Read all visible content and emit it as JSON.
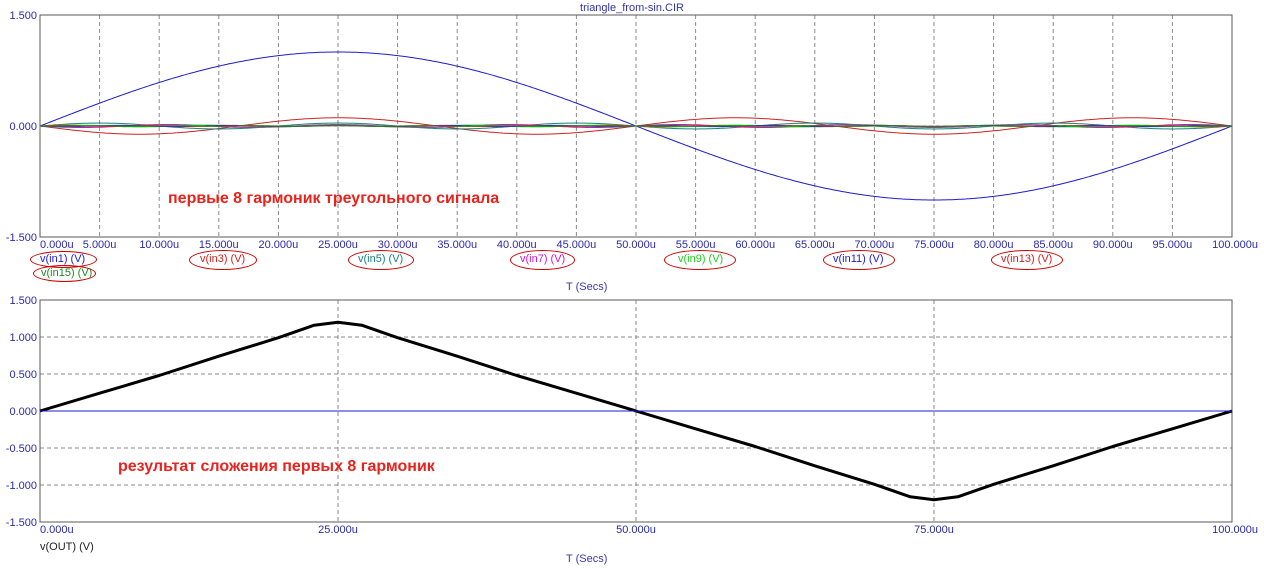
{
  "window": {
    "title": "triangle_from-sin.CIR"
  },
  "colors": {
    "axis_text": "#2a2aa8",
    "grid": "#8a8a8a",
    "annotation": "#e8221c",
    "ellipse": "#cc0000"
  },
  "top_panel": {
    "annotation": "первые 8 гармоник треугольного сигнала",
    "xtitle": "T (Secs)",
    "legend": [
      {
        "label": "v(in1) (V)",
        "color": "#1c1cd0"
      },
      {
        "label": "v(in15) (V)",
        "color": "#1f8a1f"
      },
      {
        "label": "v(in3) (V)",
        "color": "#cc2222"
      },
      {
        "label": "v(in5) (V)",
        "color": "#1d7f7f"
      },
      {
        "label": "v(in7) (V)",
        "color": "#c818c8"
      },
      {
        "label": "v(in9) (V)",
        "color": "#22cc22"
      },
      {
        "label": "v(in11) (V)",
        "color": "#1c1cd0"
      },
      {
        "label": "v(in13) (V)",
        "color": "#cc2222"
      }
    ]
  },
  "bottom_panel": {
    "annotation": "результат сложения первых 8 гармоник",
    "xtitle": "T (Secs)",
    "legend": [
      {
        "label": "v(OUT) (V)",
        "color": "#222222"
      }
    ]
  },
  "chart_data": [
    {
      "type": "line",
      "title": "triangle_from-sin.CIR",
      "xlabel": "T (Secs)",
      "ylabel": "",
      "xlim": [
        0,
        100
      ],
      "x_unit": "u",
      "ylim": [
        -1.5,
        1.5
      ],
      "y_ticks": [
        "1.500",
        "0.000",
        "-1.500"
      ],
      "x_ticks": [
        "0.000u",
        "5.000u",
        "10.000u",
        "15.000u",
        "20.000u",
        "25.000u",
        "30.000u",
        "35.000u",
        "40.000u",
        "45.000u",
        "50.000u",
        "55.000u",
        "60.000u",
        "65.000u",
        "70.000u",
        "75.000u",
        "80.000u",
        "85.000u",
        "90.000u",
        "95.000u",
        "100.000u"
      ],
      "x_tick_values": [
        0,
        5,
        10,
        15,
        20,
        25,
        30,
        35,
        40,
        45,
        50,
        55,
        60,
        65,
        70,
        75,
        80,
        85,
        90,
        95,
        100
      ],
      "grid": true,
      "series": [
        {
          "name": "v(in1) (V)",
          "color": "#1c1cd0",
          "width": 1,
          "amplitude": 1.0,
          "harmonic": 1,
          "period": 100
        },
        {
          "name": "v(in3) (V)",
          "color": "#cc2222",
          "width": 1,
          "amplitude": -0.111,
          "harmonic": 3,
          "period": 100
        },
        {
          "name": "v(in5) (V)",
          "color": "#1d7f7f",
          "width": 1,
          "amplitude": 0.04,
          "harmonic": 5,
          "period": 100
        },
        {
          "name": "v(in7) (V)",
          "color": "#c818c8",
          "width": 1,
          "amplitude": -0.0204,
          "harmonic": 7,
          "period": 100
        },
        {
          "name": "v(in9) (V)",
          "color": "#22cc22",
          "width": 1,
          "amplitude": 0.0123,
          "harmonic": 9,
          "period": 100
        },
        {
          "name": "v(in11) (V)",
          "color": "#1c1cd0",
          "width": 1,
          "amplitude": -0.0083,
          "harmonic": 11,
          "period": 100
        },
        {
          "name": "v(in13) (V)",
          "color": "#cc2222",
          "width": 1,
          "amplitude": 0.0059,
          "harmonic": 13,
          "period": 100
        },
        {
          "name": "v(in15) (V)",
          "color": "#1f8a1f",
          "width": 1,
          "amplitude": -0.0044,
          "harmonic": 15,
          "period": 100
        }
      ]
    },
    {
      "type": "line",
      "title": "",
      "xlabel": "T (Secs)",
      "ylabel": "",
      "xlim": [
        0,
        100
      ],
      "x_unit": "u",
      "ylim": [
        -1.5,
        1.5
      ],
      "y_ticks": [
        "1.500",
        "1.000",
        "0.500",
        "0.000",
        "-0.500",
        "-1.000",
        "-1.500"
      ],
      "y_tick_values": [
        1.5,
        1.0,
        0.5,
        0.0,
        -0.5,
        -1.0,
        -1.5
      ],
      "x_ticks": [
        "0.000u",
        "25.000u",
        "50.000u",
        "75.000u",
        "100.000u"
      ],
      "x_tick_values": [
        0,
        25,
        50,
        75,
        100
      ],
      "grid": true,
      "series": [
        {
          "name": "v(OUT) (V)",
          "color": "#000000",
          "width": 3,
          "x": [
            0,
            5,
            10,
            15,
            20,
            23,
            25,
            27,
            30,
            35,
            40,
            45,
            50,
            55,
            60,
            65,
            70,
            73,
            75,
            77,
            80,
            85,
            90,
            95,
            100
          ],
          "y": [
            0,
            0.24,
            0.48,
            0.74,
            0.99,
            1.16,
            1.2,
            1.16,
            0.99,
            0.74,
            0.48,
            0.24,
            0,
            -0.24,
            -0.48,
            -0.74,
            -0.99,
            -1.16,
            -1.2,
            -1.16,
            -0.99,
            -0.74,
            -0.48,
            -0.24,
            0
          ]
        },
        {
          "name": "",
          "color": "#1c1cd0",
          "width": 1,
          "x": [
            0,
            100
          ],
          "y": [
            0,
            0
          ]
        }
      ]
    }
  ]
}
